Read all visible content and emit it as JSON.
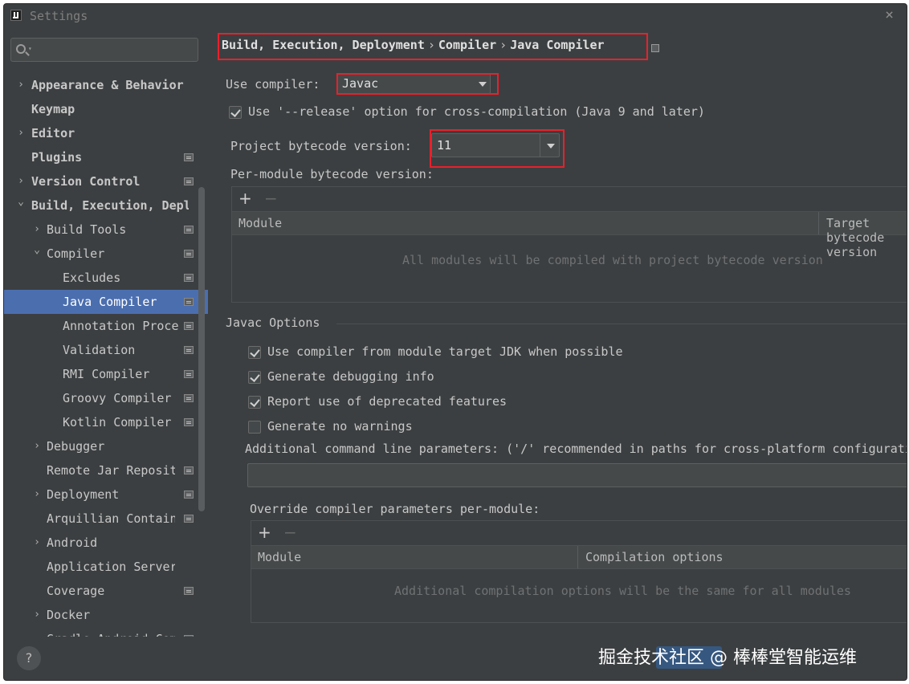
{
  "window": {
    "title": "Settings"
  },
  "search": {
    "placeholder": ""
  },
  "sidebar": {
    "items": [
      {
        "label": "Appearance & Behavior",
        "level": 0,
        "arrow": "right",
        "badge": false
      },
      {
        "label": "Keymap",
        "level": 0,
        "arrow": "",
        "badge": false
      },
      {
        "label": "Editor",
        "level": 0,
        "arrow": "right",
        "badge": false
      },
      {
        "label": "Plugins",
        "level": 0,
        "arrow": "",
        "badge": true
      },
      {
        "label": "Version Control",
        "level": 0,
        "arrow": "right",
        "badge": true
      },
      {
        "label": "Build, Execution, Deployment",
        "level": 0,
        "arrow": "down",
        "badge": false
      },
      {
        "label": "Build Tools",
        "level": 1,
        "arrow": "right",
        "badge": true
      },
      {
        "label": "Compiler",
        "level": 1,
        "arrow": "down",
        "badge": true
      },
      {
        "label": "Excludes",
        "level": 2,
        "arrow": "",
        "badge": true
      },
      {
        "label": "Java Compiler",
        "level": 2,
        "arrow": "",
        "badge": true,
        "selected": true
      },
      {
        "label": "Annotation Processors",
        "level": 2,
        "arrow": "",
        "badge": true
      },
      {
        "label": "Validation",
        "level": 2,
        "arrow": "",
        "badge": true
      },
      {
        "label": "RMI Compiler",
        "level": 2,
        "arrow": "",
        "badge": true
      },
      {
        "label": "Groovy Compiler",
        "level": 2,
        "arrow": "",
        "badge": true
      },
      {
        "label": "Kotlin Compiler",
        "level": 2,
        "arrow": "",
        "badge": true
      },
      {
        "label": "Debugger",
        "level": 1,
        "arrow": "right",
        "badge": false
      },
      {
        "label": "Remote Jar Repositories",
        "level": 1,
        "arrow": "",
        "badge": true
      },
      {
        "label": "Deployment",
        "level": 1,
        "arrow": "right",
        "badge": true
      },
      {
        "label": "Arquillian Containers",
        "level": 1,
        "arrow": "",
        "badge": true
      },
      {
        "label": "Android",
        "level": 1,
        "arrow": "right",
        "badge": false
      },
      {
        "label": "Application Servers",
        "level": 1,
        "arrow": "",
        "badge": false
      },
      {
        "label": "Coverage",
        "level": 1,
        "arrow": "",
        "badge": true
      },
      {
        "label": "Docker",
        "level": 1,
        "arrow": "right",
        "badge": false
      },
      {
        "label": "Gradle-Android Compiler",
        "level": 1,
        "arrow": "",
        "badge": true
      }
    ]
  },
  "breadcrumb": [
    "Build, Execution, Deployment",
    "Compiler",
    "Java Compiler"
  ],
  "breadcrumb_sep": "›",
  "compiler": {
    "use_compiler_label": "Use compiler:",
    "use_compiler_value": "Javac",
    "release_option_label": "Use '--release' option for cross-compilation (Java 9 and later)",
    "release_option_checked": true,
    "bytecode_label": "Project bytecode version:",
    "bytecode_value": "11",
    "per_module_label": "Per-module bytecode version:"
  },
  "module_table": {
    "columns": [
      "Module",
      "Target bytecode version"
    ],
    "empty_text": "All modules will be compiled with project bytecode version"
  },
  "javac": {
    "section_title": "Javac Options",
    "options": [
      {
        "label": "Use compiler from module target JDK when possible",
        "checked": true
      },
      {
        "label": "Generate debugging info",
        "checked": true
      },
      {
        "label": "Report use of deprecated features",
        "checked": true
      },
      {
        "label": "Generate no warnings",
        "checked": false
      }
    ],
    "additional_params_label": "Additional command line parameters:  ('/' recommended in paths for cross-platform configurations)",
    "additional_params_value": "",
    "override_label": "Override compiler parameters per-module:"
  },
  "override_table": {
    "columns": [
      "Module",
      "Compilation options"
    ],
    "empty_text": "Additional compilation options will be the same for all modules"
  },
  "footer": {
    "help_label": "?",
    "watermark": "掘金技术社区 @ 棒棒堂智能运维"
  },
  "colors": {
    "selection": "#4b6eaf",
    "highlight": "#e8212b",
    "background": "#3c3f41"
  }
}
